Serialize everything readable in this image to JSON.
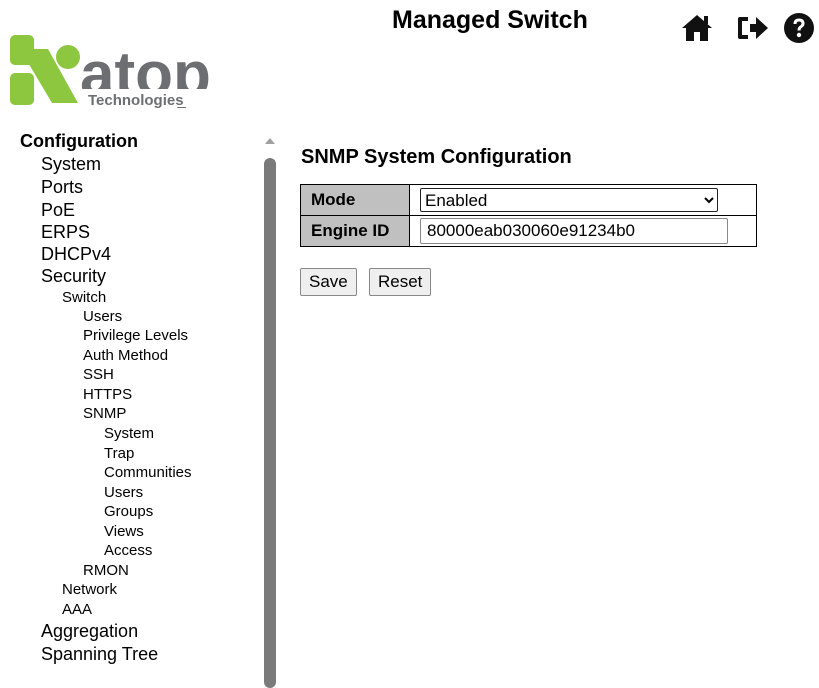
{
  "header": {
    "title": "Managed Switch",
    "logo": {
      "brand": "atop",
      "subtitle": "Technologies",
      "colors": {
        "green": "#8dc63f",
        "gray": "#6d6e71"
      }
    },
    "icons": [
      "home-icon",
      "logout-icon",
      "help-icon"
    ]
  },
  "sidebar": {
    "items": [
      {
        "label": "Configuration",
        "level": 0
      },
      {
        "label": "System",
        "level": 1
      },
      {
        "label": "Ports",
        "level": 1
      },
      {
        "label": "PoE",
        "level": 1
      },
      {
        "label": "ERPS",
        "level": 1
      },
      {
        "label": "DHCPv4",
        "level": 1
      },
      {
        "label": "Security",
        "level": 1
      },
      {
        "label": "Switch",
        "level": 2
      },
      {
        "label": "Users",
        "level": 3
      },
      {
        "label": "Privilege Levels",
        "level": 3
      },
      {
        "label": "Auth Method",
        "level": 3
      },
      {
        "label": "SSH",
        "level": 3
      },
      {
        "label": "HTTPS",
        "level": 3
      },
      {
        "label": "SNMP",
        "level": 3
      },
      {
        "label": "System",
        "level": 4
      },
      {
        "label": "Trap",
        "level": 4
      },
      {
        "label": "Communities",
        "level": 4
      },
      {
        "label": "Users",
        "level": 4
      },
      {
        "label": "Groups",
        "level": 4
      },
      {
        "label": "Views",
        "level": 4
      },
      {
        "label": "Access",
        "level": 4
      },
      {
        "label": "RMON",
        "level": 3
      },
      {
        "label": "Network",
        "level": 2
      },
      {
        "label": "AAA",
        "level": 2
      },
      {
        "label": "Aggregation",
        "level": 1
      },
      {
        "label": "Spanning Tree",
        "level": 1
      }
    ]
  },
  "main": {
    "section_title": "SNMP System Configuration",
    "mode_label": "Mode",
    "mode_value": "Enabled",
    "mode_options": [
      "Enabled"
    ],
    "engine_id_label": "Engine ID",
    "engine_id_value": "80000eab030060e91234b0",
    "save_label": "Save",
    "reset_label": "Reset"
  }
}
